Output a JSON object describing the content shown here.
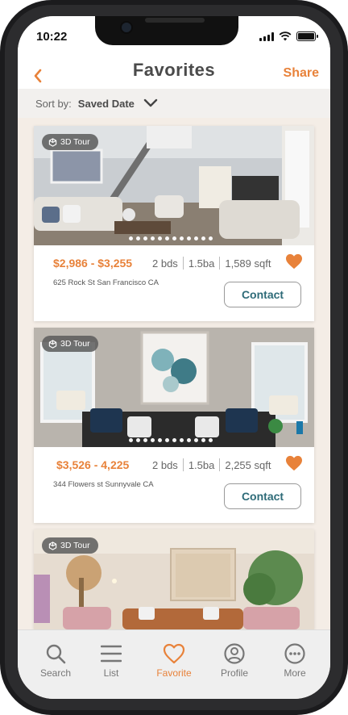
{
  "status_bar": {
    "time": "10:22"
  },
  "nav": {
    "title": "Favorites",
    "share_label": "Share"
  },
  "sort": {
    "label": "Sort by:",
    "value": "Saved Date"
  },
  "listings": [
    {
      "tour_label": "3D Tour",
      "price": "$2,986 - $3,255",
      "beds": "2 bds",
      "baths": "1.5ba",
      "sqft": "1,589 sqft",
      "address": "625 Rock St San Francisco CA",
      "contact_label": "Contact",
      "favorited": true
    },
    {
      "tour_label": "3D Tour",
      "price": "$3,526 - 4,225",
      "beds": "2 bds",
      "baths": "1.5ba",
      "sqft": "2,255 sqft",
      "address": "344 Flowers st  Sunnyvale CA",
      "contact_label": "Contact",
      "favorited": true
    },
    {
      "tour_label": "3D Tour"
    }
  ],
  "tabs": [
    {
      "label": "Search",
      "icon": "search-icon",
      "active": false
    },
    {
      "label": "List",
      "icon": "list-icon",
      "active": false
    },
    {
      "label": "Favorite",
      "icon": "heart-icon",
      "active": true
    },
    {
      "label": "Profile",
      "icon": "profile-icon",
      "active": false
    },
    {
      "label": "More",
      "icon": "more-icon",
      "active": false
    }
  ],
  "colors": {
    "accent": "#e8823a",
    "contact_text": "#2e6b78",
    "background": "#f4ede6"
  }
}
